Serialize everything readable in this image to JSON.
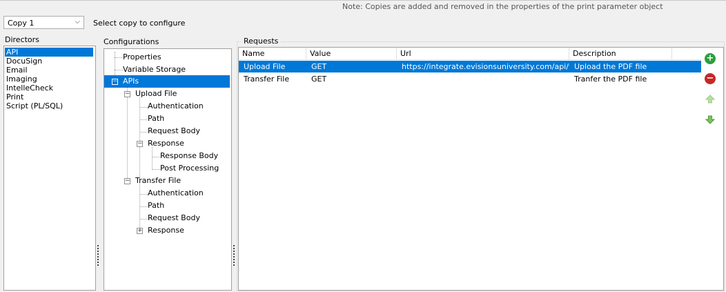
{
  "note": "Note: Copies are added and removed in the properties of the print parameter object",
  "copy_select": {
    "value": "Copy 1",
    "label": "Select copy to configure"
  },
  "directors": {
    "title": "Directors",
    "items": [
      "API",
      "DocuSign",
      "Email",
      "Imaging",
      "IntelleCheck",
      "Print",
      "Script (PL/SQL)"
    ],
    "selected": "API"
  },
  "configurations": {
    "title": "Configurations",
    "nodes": {
      "properties": "Properties",
      "variable_storage": "Variable Storage",
      "apis": "APIs",
      "upload_file": "Upload File",
      "uf_authentication": "Authentication",
      "uf_path": "Path",
      "uf_request_body": "Request Body",
      "uf_response": "Response",
      "uf_response_body": "Response Body",
      "uf_post_processing": "Post Processing",
      "transfer_file": "Transfer File",
      "tf_authentication": "Authentication",
      "tf_path": "Path",
      "tf_request_body": "Request Body",
      "tf_response": "Response"
    }
  },
  "requests": {
    "title": "Requests",
    "columns": [
      "Name",
      "Value",
      "Url",
      "Description"
    ],
    "rows": [
      [
        "Upload File",
        "GET",
        "https://integrate.evisionsuniversity.com/api/fil...",
        "Upload the PDF file"
      ],
      [
        "Transfer File",
        "GET",
        "",
        "Tranfer the PDF file"
      ]
    ]
  },
  "colors": {
    "selection": "#0078d7",
    "add": "#2e9e3e",
    "remove": "#c62828",
    "arrow": "#7cc35c"
  }
}
